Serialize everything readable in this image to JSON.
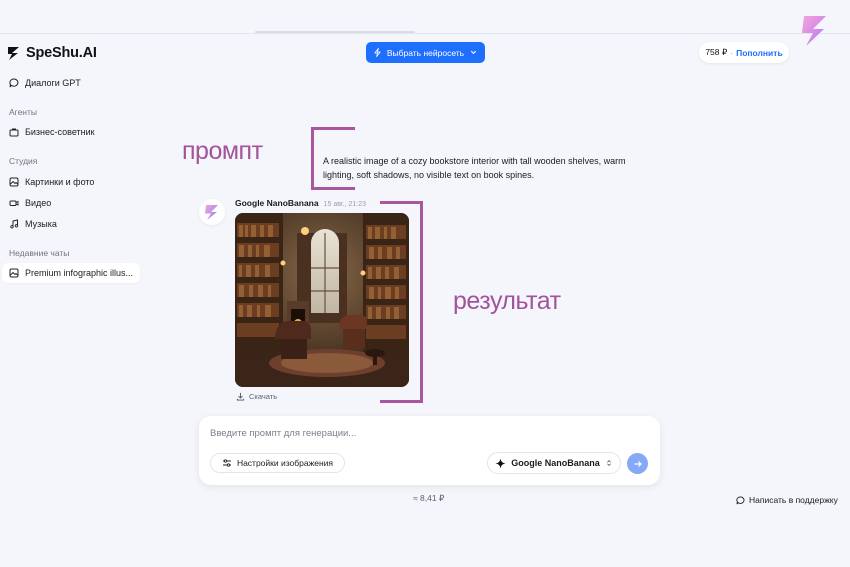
{
  "app": {
    "brand": "SpeShu.AI"
  },
  "sidebar": {
    "items": [
      {
        "label": "Диалоги GPT",
        "icon": "chat-bubble-icon"
      },
      {
        "label": "Бизнес-советник",
        "icon": "briefcase-icon"
      },
      {
        "label": "Картинки и фото",
        "icon": "image-icon"
      },
      {
        "label": "Видео",
        "icon": "video-camera-icon"
      },
      {
        "label": "Музыка",
        "icon": "music-note-icon"
      }
    ],
    "sections": {
      "agents": "Агенты",
      "studio": "Студия",
      "recent": "Недавние чаты"
    },
    "recent_chats": [
      {
        "label": "Premium infographic illus...",
        "icon": "image-icon"
      }
    ]
  },
  "header": {
    "choose_model_label": "Выбрать нейросеть",
    "balance": "758 ₽",
    "balance_separator": "·",
    "topup_label": "Пополнить"
  },
  "annotations": {
    "prompt": "промпт",
    "result": "результат"
  },
  "chat": {
    "prompt_text": "A realistic image of a cozy bookstore interior with tall wooden shelves, warm lighting, soft shadows, no visible text on book spines.",
    "result": {
      "model": "Google NanoBanana",
      "time": "15 авг., 21:23",
      "download_label": "Скачать"
    }
  },
  "composer": {
    "placeholder": "Введите промпт для генерации...",
    "settings_label": "Настройки изображения",
    "model_label": "Google NanoBanana"
  },
  "footer": {
    "cost": "≈ 8,41 ₽",
    "support_label": "Написать в поддержку"
  },
  "colors": {
    "accent": "#1f6fff",
    "annotation": "#a9559f",
    "background": "#f4f6fb"
  }
}
